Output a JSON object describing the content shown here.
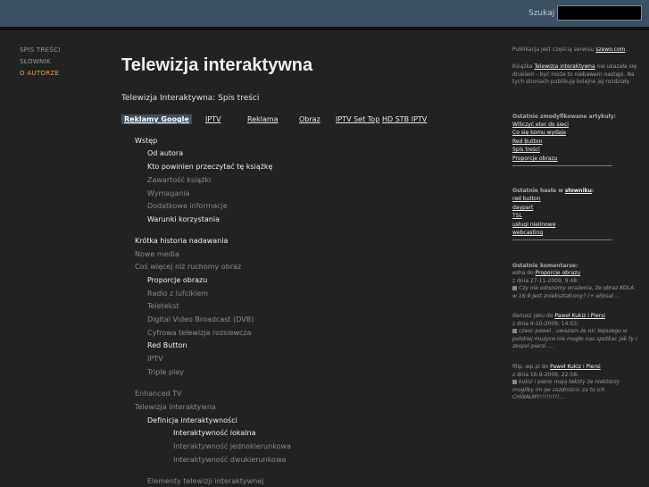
{
  "header": {
    "search_label": "Szukaj",
    "search_value": ""
  },
  "left_nav": [
    {
      "label": "SPIS TREŚCI"
    },
    {
      "label": "SŁOWNIK"
    },
    {
      "label": "O AUTORZE"
    }
  ],
  "main": {
    "title": "Telewizja interaktywna",
    "subtitle": "Telewizja Interaktywna: Spis treści",
    "tabs": [
      "Reklamy Google",
      "IPTV",
      "Reklama",
      "Obraz",
      "IPTV Set Top",
      "HD STB IPTV"
    ],
    "toc": [
      {
        "label": "Wstęp"
      },
      {
        "label": "Od autora"
      },
      {
        "label": "Kto powinien przeczytać tę książkę"
      },
      {
        "label": "Zawartość książki"
      },
      {
        "label": "Wymagania"
      },
      {
        "label": "Dodatkowe informacje"
      },
      {
        "label": "Warunki korzystania"
      },
      {
        "label": "Krótka historia nadawania"
      },
      {
        "label": "Nowe media"
      },
      {
        "label": "Coś więcej niż ruchomy obraz"
      },
      {
        "label": "Proporcje obrazu"
      },
      {
        "label": "Radio z lufcikiem"
      },
      {
        "label": "Teletekst"
      },
      {
        "label": "Digital Video Broadcast (DVB)"
      },
      {
        "label": "Cyfrowa telewizja rozsiewcza"
      },
      {
        "label": "Red Button"
      },
      {
        "label": "IPTV"
      },
      {
        "label": "Triple play"
      },
      {
        "label": "Enhanced TV"
      },
      {
        "label": "Telewizja interaktywna"
      },
      {
        "label": "Definicja interaktywności"
      },
      {
        "label": "Interaktywność lokalna"
      },
      {
        "label": "Interaktywność jednokierunkowa"
      },
      {
        "label": "Interaktywność dwukierunkowa"
      },
      {
        "label": "Elementy telewizji interaktywnej"
      }
    ]
  },
  "sidebar": {
    "intro_pre": "Publikacja jest częścią serwisu",
    "intro_link": "szewo.com",
    "intro_post": ".",
    "book_pre": "Książka",
    "book_link": "Telewizja interaktywna",
    "book_post": "nie ukazała się drukiem - być może to niebawem nastąpi. Na tych stronach publikuję kolejne jej rozdziały.",
    "modified_heading": "Ostatnio zmodyfikowane artykuły:",
    "modified_articles": [
      "Wiliczyć eter do sieci",
      "Co się komu wydaje",
      "Red Button",
      "Spis treści",
      "Proporcje obrazu"
    ],
    "terms_heading_pre": "Ostatnie hasła w",
    "terms_heading_link": "słowniku",
    "terms_heading_post": ":",
    "terms": [
      "red button",
      "daypart",
      "TSL",
      "usługi nielinowe",
      "webcasting"
    ],
    "comments_heading": "Ostatnie komentarze:",
    "comments": [
      {
        "author_pre": "esha do",
        "link": "Proporcje obrazu",
        "date": "z dnia 27-11-2009, 9:48:",
        "text": "Czy nie odnosimy wrażenia, że obraz KOLA w 16:9 jest zniekształcony? (+ elipsa)...."
      },
      {
        "author_pre": "dariusz jaku do",
        "link": "Paweł Kukiz i Piersi",
        "date": "z dnia 9-10-2009, 14:53:",
        "text": "czesc pawel . uwazam ze nic lepszego w polskiej muzyce nie mogło nas spotkac jak ty i zespol piersi ...."
      },
      {
        "author_pre": "filip .wp.pl do",
        "link": "Paweł Kukiz i Piersi",
        "date": "z dnia 16-9-2009, 22:58:",
        "text": "kukiz i piersi mają teksty że niektórzy mogliby im pe zazdrościc za to ich CHWALMY!!!!!!!!!...."
      }
    ]
  }
}
